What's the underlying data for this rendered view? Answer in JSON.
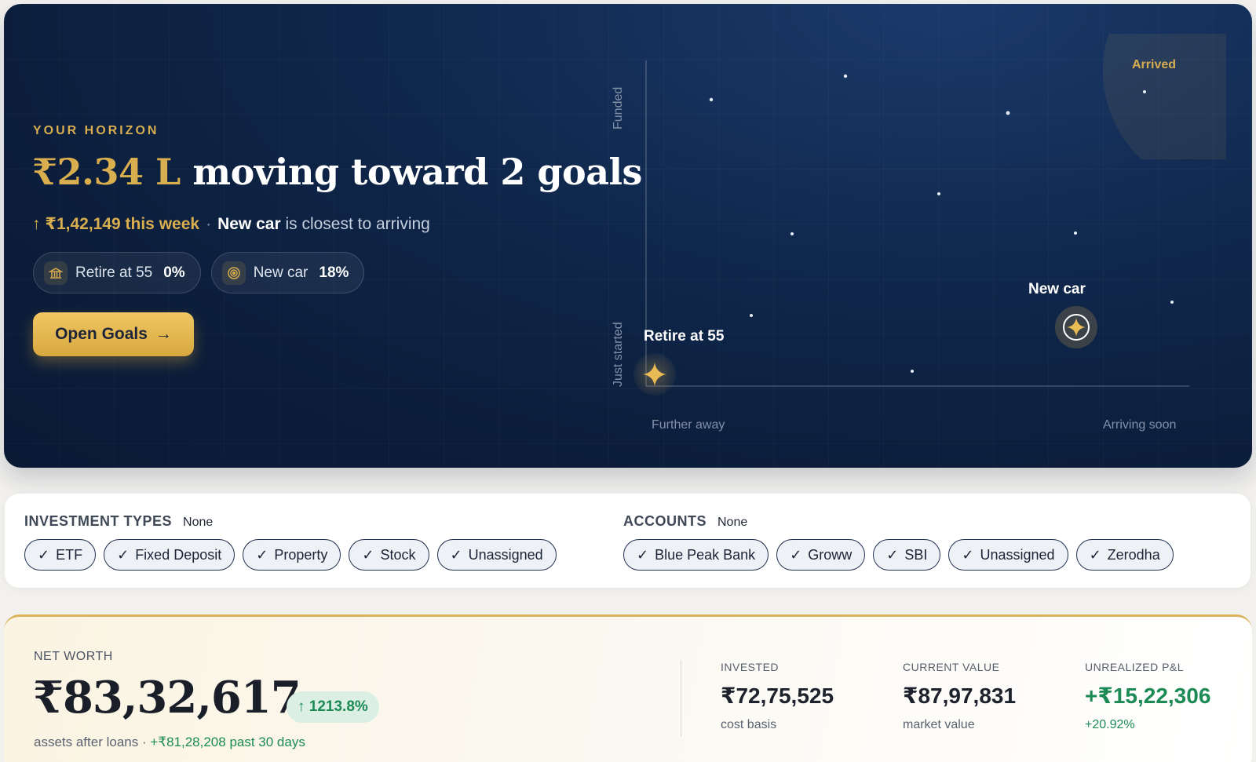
{
  "hero": {
    "eyebrow": "YOUR HORIZON",
    "amount": "₹2.34 L",
    "headline_rest": " moving toward 2 goals",
    "weekly_change": "↑ ₹1,42,149 this week",
    "separator": "·",
    "closest_goal": "New car",
    "closest_text": " is closest to arriving",
    "chips": [
      {
        "icon": "bank-icon",
        "label": "Retire at 55",
        "percent": "0%"
      },
      {
        "icon": "target-icon",
        "label": "New car",
        "percent": "18%"
      }
    ],
    "cta_label": "Open Goals",
    "cta_arrow": "→"
  },
  "horizon_chart": {
    "y_axis_top": "Funded",
    "y_axis_bottom": "Just started",
    "x_axis_left": "Further away",
    "x_axis_right": "Arriving soon",
    "zone_label": "Arrived",
    "goals": [
      {
        "name": "Retire at 55",
        "funded_pct": 0,
        "proximity": 0.02
      },
      {
        "name": "New car",
        "funded_pct": 18,
        "proximity": 0.8
      }
    ]
  },
  "filters": {
    "investment_types": {
      "title": "INVESTMENT TYPES",
      "selection": "None",
      "options": [
        "ETF",
        "Fixed Deposit",
        "Property",
        "Stock",
        "Unassigned"
      ]
    },
    "accounts": {
      "title": "ACCOUNTS",
      "selection": "None",
      "options": [
        "Blue Peak Bank",
        "Groww",
        "SBI",
        "Unassigned",
        "Zerodha"
      ]
    },
    "check_glyph": "✓"
  },
  "net_worth": {
    "label": "NET WORTH",
    "value": "₹83,32,617",
    "change": "↑ 1213.8%",
    "sub_prefix": "assets after loans · ",
    "sub_change": "+₹81,28,208 past 30 days",
    "stats": [
      {
        "label": "INVESTED",
        "value": "₹72,75,525",
        "sub": "cost basis"
      },
      {
        "label": "CURRENT VALUE",
        "value": "₹87,97,831",
        "sub": "market value"
      },
      {
        "label": "UNREALIZED P&L",
        "value": "+₹15,22,306",
        "sub": "+20.92%"
      }
    ]
  },
  "colors": {
    "hero_bg": "#0b1d3a",
    "gold": "#d9ae4f",
    "positive": "#1c8a55"
  }
}
